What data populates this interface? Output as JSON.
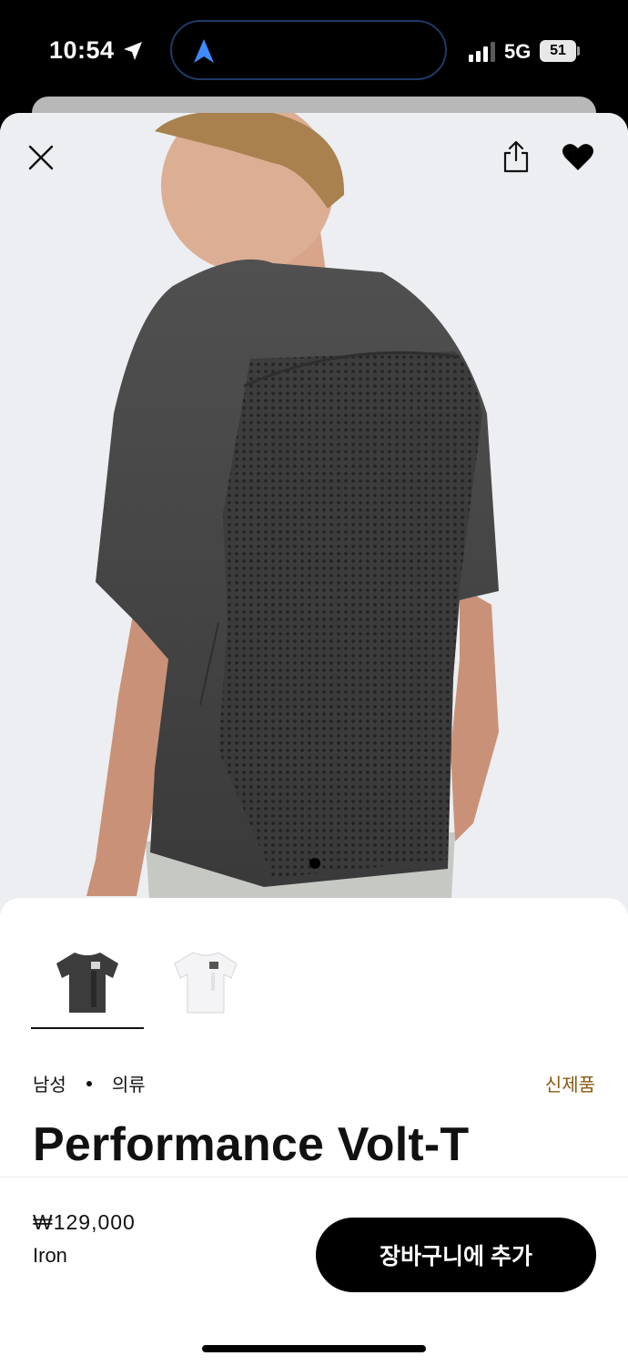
{
  "status": {
    "time": "10:54",
    "network": "5G",
    "battery": "51"
  },
  "product": {
    "breadcrumb": [
      "남성",
      "의류"
    ],
    "badge": "신제품",
    "title": "Performance Volt-T",
    "price": "₩129,000",
    "color": "Iron"
  },
  "swatches": [
    {
      "name": "dark-grey",
      "selected": true,
      "color": "#3c3c3c"
    },
    {
      "name": "white",
      "selected": false,
      "color": "#f4f4f6"
    }
  ],
  "actions": {
    "add_to_cart": "장바구니에 추가"
  },
  "icons": {
    "close": "close-icon",
    "share": "share-icon",
    "wishlist": "heart-icon"
  },
  "carousel": {
    "current": 1,
    "total": 1
  }
}
